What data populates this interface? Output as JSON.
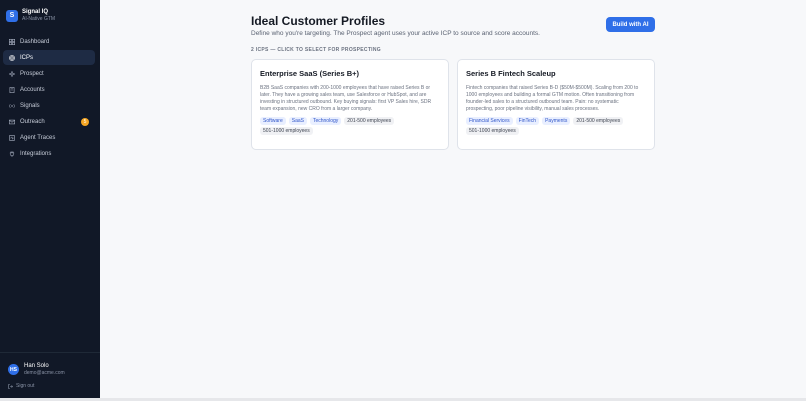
{
  "brand": {
    "logo_letter": "S",
    "name": "Signal IQ",
    "tagline": "AI-Native GTM"
  },
  "sidebar": {
    "items": [
      {
        "label": "Dashboard",
        "icon": "grid-icon",
        "active": false
      },
      {
        "label": "ICPs",
        "icon": "target-icon",
        "active": true
      },
      {
        "label": "Prospect",
        "icon": "sparkle-icon",
        "active": false
      },
      {
        "label": "Accounts",
        "icon": "building-icon",
        "active": false
      },
      {
        "label": "Signals",
        "icon": "radio-icon",
        "active": false
      },
      {
        "label": "Outreach",
        "icon": "mail-icon",
        "active": false,
        "badge": "5"
      },
      {
        "label": "Agent Traces",
        "icon": "activity-icon",
        "active": false
      },
      {
        "label": "Integrations",
        "icon": "plug-icon",
        "active": false
      }
    ]
  },
  "user": {
    "initials": "HS",
    "name": "Han Solo",
    "email": "demo@acme.com",
    "signout_label": "Sign out"
  },
  "header": {
    "title": "Ideal Customer Profiles",
    "subtitle": "Define who you're targeting. The Prospect agent uses your active ICP to source and score accounts.",
    "build_button": "Build with AI"
  },
  "section_label": "2 ICPS — CLICK TO SELECT FOR PROSPECTING",
  "icps": [
    {
      "title": "Enterprise SaaS (Series B+)",
      "description": "B2B SaaS companies with 200-1000 employees that have raised Series B or later. They have a growing sales team, use Salesforce or HubSpot, and are investing in structured outbound. Key buying signals: first VP Sales hire, SDR team expansion, new CRO from a larger company.",
      "industry_tags": [
        "Software",
        "SaaS",
        "Technology"
      ],
      "size_tags": [
        "201-500 employees",
        "501-1000 employees"
      ]
    },
    {
      "title": "Series B Fintech Scaleup",
      "description": "Fintech companies that raised Series B-D ($50M-$500M). Scaling from 200 to 1000 employees and building a formal GTM motion. Often transitioning from founder-led sales to a structured outbound team. Pain: no systematic prospecting, poor pipeline visibility, manual sales processes.",
      "industry_tags": [
        "Financial Services",
        "FinTech",
        "Payments"
      ],
      "size_tags": [
        "201-500 employees",
        "501-1000 employees"
      ]
    }
  ],
  "colors": {
    "sidebar_bg": "#111827",
    "accent": "#2f6fe8",
    "badge": "#f5a623"
  }
}
